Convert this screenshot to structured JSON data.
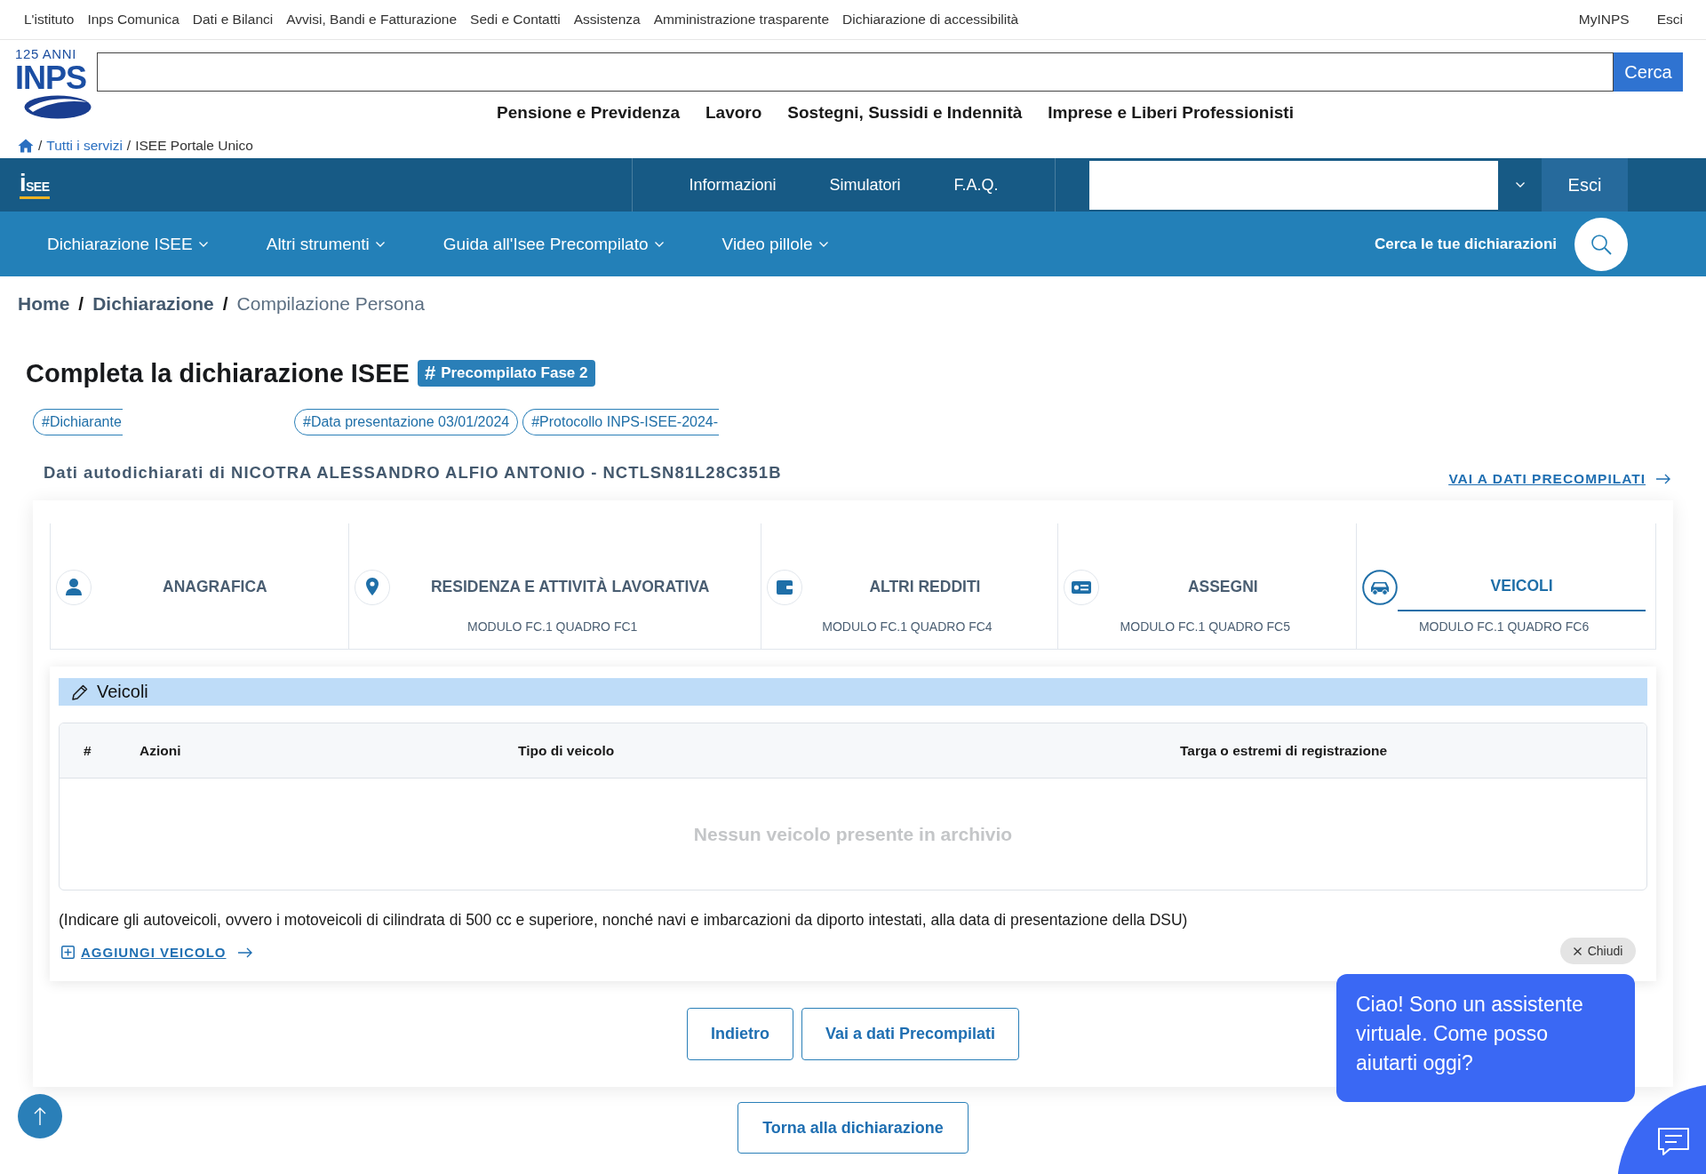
{
  "top_bar": {
    "links": [
      "L'istituto",
      "Inps Comunica",
      "Dati e Bilanci",
      "Avvisi, Bandi e Fatturazione",
      "Sedi e Contatti",
      "Assistenza",
      "Amministrazione trasparente",
      "Dichiarazione di accessibilità"
    ],
    "account_links": [
      "MyINPS",
      "Esci"
    ]
  },
  "header": {
    "logo": {
      "anniversary": "125 ANNI",
      "name": "INPS"
    },
    "search": {
      "button": "Cerca"
    },
    "nav": [
      "Pensione e Previdenza",
      "Lavoro",
      "Sostegni, Sussidi e Indennità",
      "Imprese e Liberi Professionisti"
    ],
    "breadcrumb": [
      {
        "separator": "/",
        "label": "Tutti i servizi",
        "kind": "link"
      },
      {
        "separator": "/",
        "label": "ISEE Portale Unico",
        "kind": "current"
      }
    ]
  },
  "isee_bar": {
    "logo": "iSEE",
    "links": [
      "Informazioni",
      "Simulatori",
      "F.A.Q."
    ],
    "button": "Esci"
  },
  "isee_nav": {
    "items": [
      {
        "label": "Dichiarazione ISEE",
        "has_menu": true
      },
      {
        "label": "Altri strumenti",
        "has_menu": true
      },
      {
        "label": "Guida all'Isee Precompilato",
        "has_menu": true
      },
      {
        "label": "Video pillole",
        "has_menu": true
      }
    ],
    "search_label": "Cerca le tue dichiarazioni"
  },
  "breadcrumb": [
    {
      "label": "Home",
      "kind": "link"
    },
    {
      "separator": "/",
      "label": "Dichiarazione",
      "kind": "link"
    },
    {
      "separator": "/",
      "label": "Compilazione Persona",
      "kind": "current"
    }
  ],
  "title": "Completa la dichiarazione ISEE",
  "badge": {
    "symbol": "#",
    "label": "Precompilato Fase 2"
  },
  "tags": [
    {
      "label": "#Dichiarante",
      "clipped": true
    },
    {
      "label": "#Data presentazione 03/01/2024",
      "clipped": false
    },
    {
      "label": "#Protocollo INPS-ISEE-2024-",
      "clipped": true
    }
  ],
  "subject": {
    "text": "Dati autodichiarati di NICOTRA ALESSANDRO ALFIO ANTONIO - NCTLSN81L28C351B",
    "link": "VAI A DATI PRECOMPILATI"
  },
  "tabs": [
    {
      "title": "ANAGRAFICA",
      "selected": false
    },
    {
      "title": "RESIDENZA E ATTIVITÀ LAVORATIVA",
      "subtitle": "MODULO FC.1 QUADRO FC1",
      "selected": false
    },
    {
      "title": "ALTRI REDDITI",
      "subtitle": "MODULO FC.1 QUADRO FC4",
      "selected": false
    },
    {
      "title": "ASSEGNI",
      "subtitle": "MODULO FC.1 QUADRO FC5",
      "selected": false
    },
    {
      "title": "VEICOLI",
      "subtitle": "MODULO FC.1 QUADRO FC6",
      "selected": true
    }
  ],
  "section": {
    "title": "Veicoli",
    "table": {
      "columns": [
        "#",
        "Azioni",
        "Tipo di veicolo",
        "Targa o estremi di registrazione"
      ],
      "empty_message": "Nessun veicolo presente in archivio"
    },
    "note": "(Indicare gli autoveicoli, ovvero i motoveicoli di cilindrata di 500 cc e superiore, nonché navi e imbarcazioni da diporto intestati, alla data di presentazione della DSU)",
    "add_link": "AGGIUNGI VEICOLO"
  },
  "buttons": [
    "Indietro",
    "Vai a dati Precompilati"
  ],
  "back_button": "Torna alla dichiarazione",
  "chat": {
    "close": "Chiudi",
    "message": "Ciao! Sono un assistente virtuale. Come posso aiutarti oggi?"
  }
}
